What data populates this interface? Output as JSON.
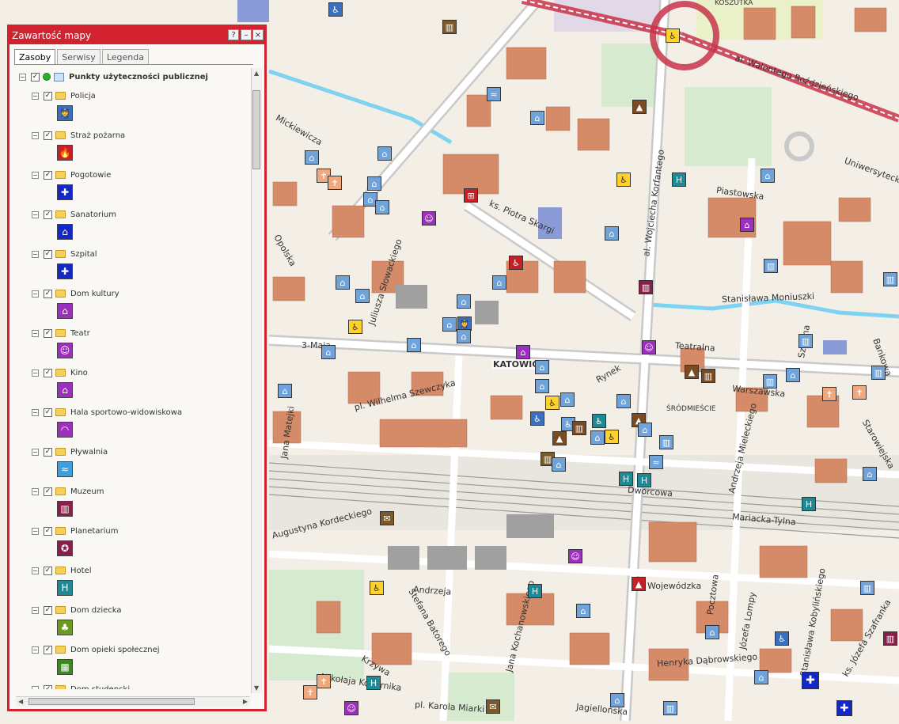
{
  "panel": {
    "title": "Zawartość mapy",
    "buttons": {
      "help": "?",
      "minimize": "–",
      "close": "×"
    },
    "tabs": [
      "Zasoby",
      "Serwisy",
      "Legenda"
    ],
    "root_label": "Punkty użyteczności publicznej",
    "layers": [
      {
        "label": "Policja",
        "icon": "police-icon",
        "color": "#3a6fbf",
        "glyph": "👮"
      },
      {
        "label": "Straż pożarna",
        "icon": "fire-icon",
        "color": "#c42026",
        "glyph": "🔥"
      },
      {
        "label": "Pogotowie",
        "icon": "ambulance-cross-icon",
        "color": "#1428c8",
        "glyph": "✚"
      },
      {
        "label": "Sanatorium",
        "icon": "sanatorium-icon",
        "color": "#1428c8",
        "glyph": "⌂"
      },
      {
        "label": "Szpital",
        "icon": "hospital-cross-icon",
        "color": "#1428c8",
        "glyph": "✚"
      },
      {
        "label": "Dom kultury",
        "icon": "culture-house-icon",
        "color": "#9d2fbd",
        "glyph": "⌂"
      },
      {
        "label": "Teatr",
        "icon": "theatre-masks-icon",
        "color": "#9d2fbd",
        "glyph": "☺"
      },
      {
        "label": "Kino",
        "icon": "cinema-icon",
        "color": "#9d2fbd",
        "glyph": "⌂"
      },
      {
        "label": "Hala sportowo-widowiskowa",
        "icon": "sports-hall-icon",
        "color": "#9d2fbd",
        "glyph": "◠"
      },
      {
        "label": "Pływalnia",
        "icon": "swimming-icon",
        "color": "#3ba0e0",
        "glyph": "≈"
      },
      {
        "label": "Muzeum",
        "icon": "museum-icon",
        "color": "#8a1f4b",
        "glyph": "▥"
      },
      {
        "label": "Planetarium",
        "icon": "planetarium-icon",
        "color": "#8a1f4b",
        "glyph": "✪"
      },
      {
        "label": "Hotel",
        "icon": "hotel-icon",
        "color": "#1e8a96",
        "glyph": "H"
      },
      {
        "label": "Dom dziecka",
        "icon": "children-home-icon",
        "color": "#6a9a20",
        "glyph": "♣"
      },
      {
        "label": "Dom opieki społecznej",
        "icon": "care-home-icon",
        "color": "#3a8a20",
        "glyph": "▦"
      },
      {
        "label": "Dom studencki",
        "icon": "student-house-icon",
        "color": "#3a6fbf",
        "glyph": "⌂"
      }
    ]
  },
  "map": {
    "labels": {
      "koszutka": "KOSZUTKA",
      "katowice": "KATOWICE",
      "srodmiescie": "ŚRÓDMIEŚCIE",
      "rozdzienskiego": "al. Walentego Roździeńskiego",
      "uniwersytecka": "Uniwersytecka",
      "piastowska": "Piastowska",
      "skargi": "ks. Piotra Skargi",
      "korfantego": "al. Wojciecha Korfantego",
      "moniuszki": "Stanisława Moniuszki",
      "teatralna": "Teatralna",
      "warszawska": "Warszawska",
      "szewczyka": "pl. Wilhelma Szewczyka",
      "mickiewicza": "Mickiewicza",
      "opolska": "Opolska",
      "slowackiego": "Juliusza Słowackiego",
      "trzecimaja": "3-Maja",
      "matejki": "Jana Matejki",
      "kordeckiego": "Augustyna Kordeckiego",
      "rynek": "Rynek",
      "dworcowa": "Dworcowa",
      "mariacka": "Mariacka-Tylna",
      "mieleckiego": "Andrzeja Mieleckiego",
      "andrzeja": "Andrzeja",
      "batorego": "Stefana Batorego",
      "kochanowskiego": "Jana Kochanowskiego",
      "wojewodzka": "Wojewódzka",
      "dabrowskiego": "Henryka Dąbrowskiego",
      "kopernika": "Mikołaja Kopernika",
      "miarki": "pl. Karola Miarki",
      "jagiellonska": "Jagiellońska",
      "lompy": "Józefa Lompy",
      "kobylinskiego": "Stanisława Kobylińskiego",
      "szafranka": "ks. Józefa Szafranka",
      "starowiejska": "Starowiejska",
      "bankowa": "Bankowa",
      "krzywa": "Krzywa",
      "pocztowa": "Pocztowa",
      "szkolna": "Szkolna"
    }
  }
}
